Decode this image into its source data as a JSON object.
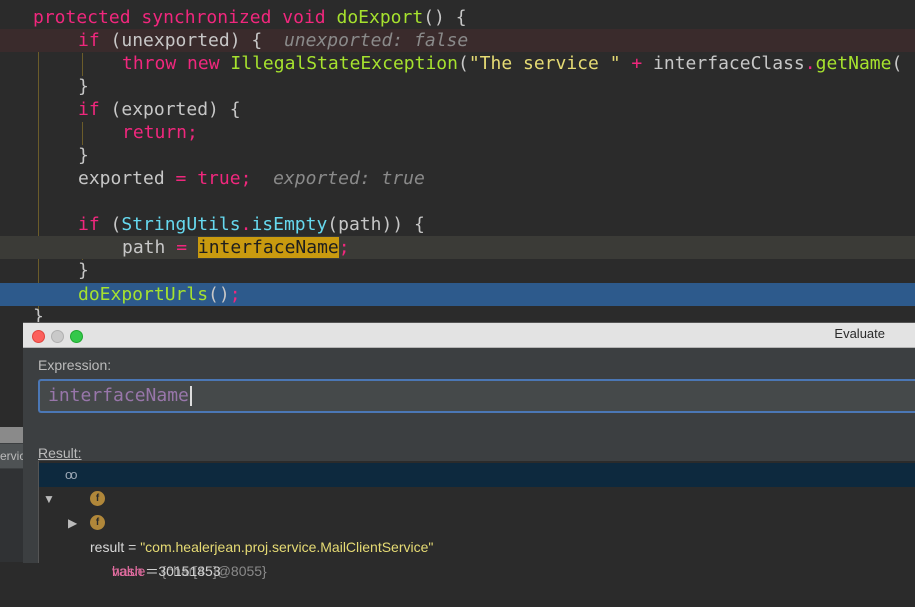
{
  "editor": {
    "line1": {
      "kw1": "protected",
      "kw2": "synchronized",
      "kw3": "void",
      "method": "doExport",
      "rest": "() {"
    },
    "line2": {
      "kw": "if",
      "cond": " (unexported) {",
      "hint": "unexported: false"
    },
    "line3": {
      "kw1": "throw",
      "kw2": "new",
      "cls": "IllegalStateException",
      "p1": "(",
      "str": "\"The service \"",
      "plus": " + ",
      "var": "interfaceClass",
      "dot": ".",
      "fn": "getName",
      "p2": "("
    },
    "line4": {
      "text": "}"
    },
    "line5": {
      "kw": "if",
      "cond": " (exported) {"
    },
    "line6": {
      "kw": "return;"
    },
    "line7": {
      "text": "}"
    },
    "line8": {
      "var": "exported",
      "eq": " = ",
      "val": "true;",
      "hint": "exported: true"
    },
    "line10": {
      "kw": "if",
      "p": " (",
      "cls": "StringUtils",
      "dot": ".",
      "fn": "isEmpty",
      "rest": "(path)) {"
    },
    "line11": {
      "var": "path",
      "eq": " = ",
      "hl": "interfaceName",
      "semi": ";"
    },
    "line12": {
      "text": "}"
    },
    "line13": {
      "fn": "doExportUrls",
      "paren": "()",
      "semi": ";"
    },
    "line14": {
      "text": "}"
    }
  },
  "dialog": {
    "title": "Evaluate",
    "expression_label": "Expression:",
    "expression_value": "interfaceName",
    "result_label": "Result:",
    "result": {
      "name": "result",
      "eq": " = ",
      "value": "\"com.healerjean.proj.service.MailClientService\"",
      "children": [
        {
          "badge": "f",
          "name": "value",
          "eq": " = ",
          "value": "{char[45]@8055}"
        },
        {
          "badge": "f",
          "name": "hash",
          "eq": " = ",
          "value": "30151853"
        }
      ]
    }
  },
  "side_panel": {
    "label": "ervic"
  }
}
